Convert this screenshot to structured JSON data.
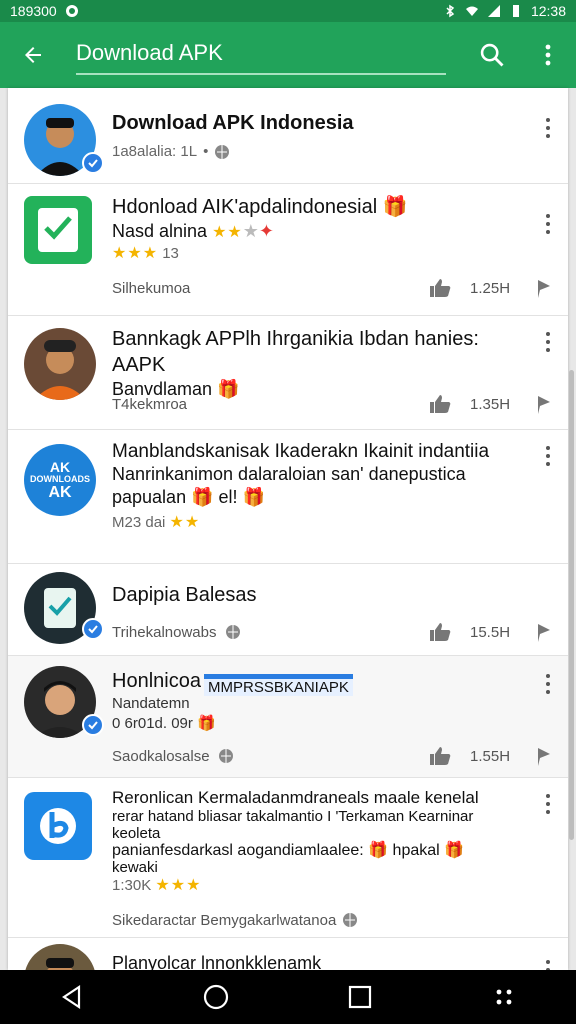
{
  "status": {
    "left_text": "189300",
    "time": "12:38"
  },
  "appbar": {
    "search_text": "Download APK"
  },
  "items": [
    {
      "title": "Download APK Indonesia",
      "meta": "1a8alalia: 1L"
    },
    {
      "title": "Hdonload AIK'apdalindonesial 🎁",
      "desc": "Nasd alnina",
      "rating": "13",
      "source": "Silhekumoa",
      "count": "1.25H"
    },
    {
      "title": "Bannkagk APPlh Ihrganikia Ibdan hanies: AAPK",
      "desc": "Banvdlaman 🎁",
      "source": "T4kekmroa",
      "count": "1.35H"
    },
    {
      "title": "Manblandskanisak Ikaderakn Ikainit indantiia",
      "desc": "Nanrinkanimon dalaraloian san' danepustica",
      "desc2": "papualan 🎁 el! 🎁",
      "meta": "M23 dai",
      "avatar_text_1": "AK",
      "avatar_text_2": "DOWNLOADS",
      "avatar_text_3": "AK"
    },
    {
      "title": "Dapipia Balesas",
      "source": "Trihekalnowabs",
      "count": "15.5H"
    },
    {
      "title": "Honlnicoa",
      "title_overlay": "MMPRSSBKANIAPK",
      "desc": "Nandatemn",
      "meta": "0 6r01d. 09r 🎁",
      "source": "Saodkalosalse",
      "count": "1.55H"
    },
    {
      "title": "Reronlican Kermaladanmdraneals maale kenelal",
      "desc": "rerar hatand bliasar takalmantio I 'Terkaman Kearninar",
      "desc2": "keoleta",
      "desc3": "panianfesdarkasl aogandiamlaalee: 🎁 hpakal 🎁",
      "desc4": "kewaki",
      "rating_prefix": "1:30K",
      "source": "Sikedaractar Bemygakarlwatanoa"
    },
    {
      "title": "Planyolcar lnnonkklenamk"
    }
  ],
  "colors": {
    "appbar": "#21a35a",
    "statusbar": "#1a8a4a",
    "badge": "#2a7de1",
    "star": "#f4b400"
  }
}
